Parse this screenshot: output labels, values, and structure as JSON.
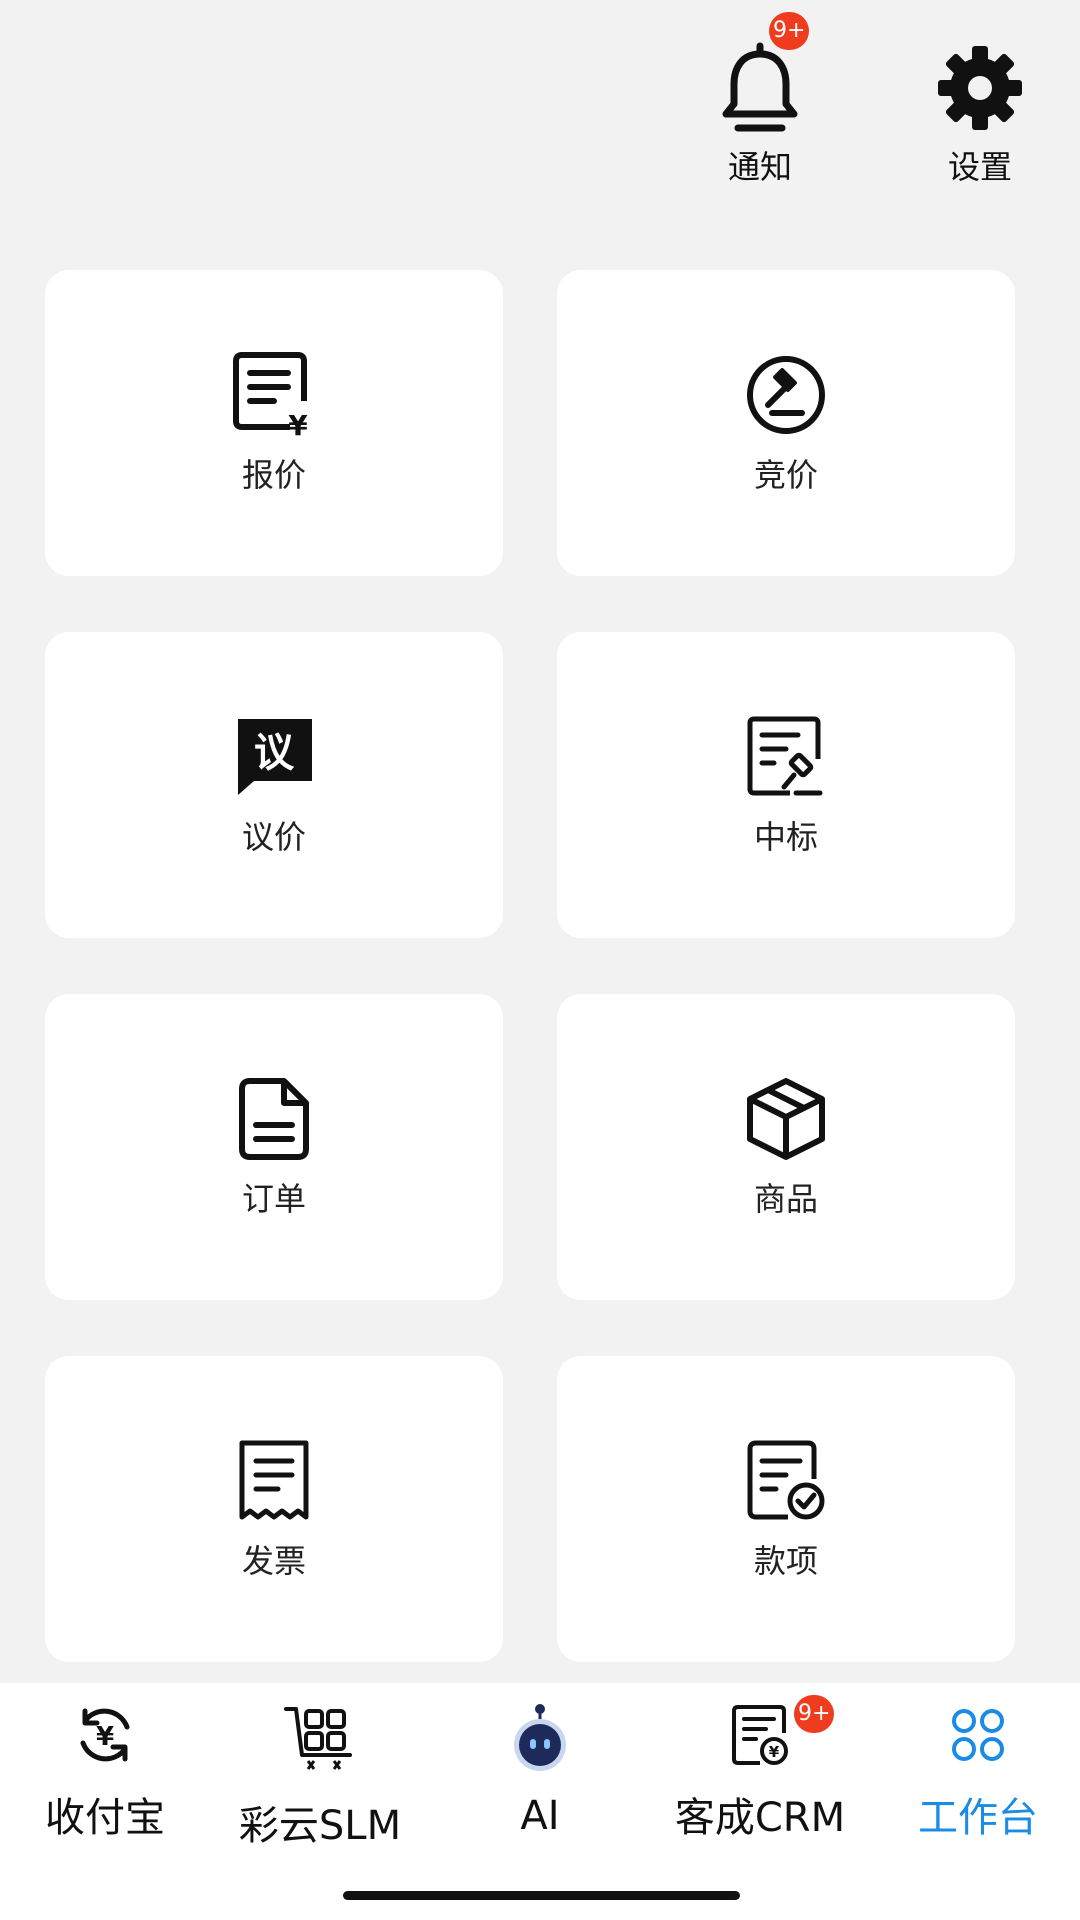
{
  "header": {
    "notify": {
      "label": "通知",
      "badge": "9+",
      "icon": "bell-icon"
    },
    "settings": {
      "label": "设置",
      "icon": "gear-icon"
    }
  },
  "grid": [
    {
      "label": "报价",
      "icon": "quote-document-icon"
    },
    {
      "label": "竞价",
      "icon": "auction-gavel-icon"
    },
    {
      "label": "议价",
      "icon": "negotiate-chat-icon",
      "icon_text": "议"
    },
    {
      "label": "中标",
      "icon": "award-document-icon"
    },
    {
      "label": "订单",
      "icon": "order-file-icon"
    },
    {
      "label": "商品",
      "icon": "product-box-icon"
    },
    {
      "label": "发票",
      "icon": "invoice-receipt-icon"
    },
    {
      "label": "款项",
      "icon": "payment-check-icon"
    }
  ],
  "tabbar": {
    "items": [
      {
        "label": "收付宝",
        "icon": "yuan-cycle-icon"
      },
      {
        "label": "彩云SLM",
        "icon": "cart-grid-icon"
      },
      {
        "label": "AI",
        "icon": "robot-icon"
      },
      {
        "label": "客成CRM",
        "icon": "crm-document-icon",
        "badge": "9+"
      },
      {
        "label": "工作台",
        "icon": "workbench-grid-icon",
        "active": true
      }
    ],
    "active_color": "#1a8ce6"
  },
  "colors": {
    "badge": "#ef3c1f",
    "background": "#f2f2f2",
    "card": "#ffffff"
  }
}
